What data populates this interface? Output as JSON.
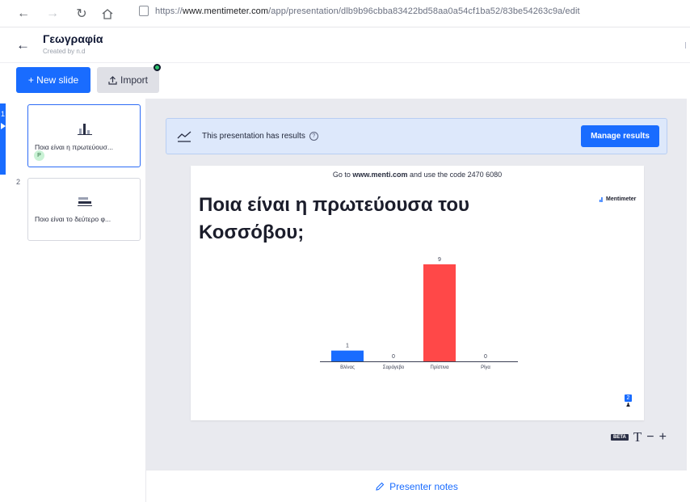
{
  "browser": {
    "url_prefix": "https://",
    "url_domain": "www.mentimeter.com",
    "url_path": "/app/presentation/dlb9b96cbba83422bd58aa0a54cf1ba52/83be54263c9a/edit"
  },
  "header": {
    "title": "Γεωγραφία",
    "subtitle": "Created by n.d"
  },
  "toolbar": {
    "new_slide_label": "+ New slide",
    "import_label": "Import"
  },
  "slides": [
    {
      "number": "1",
      "label": "Ποια είναι η πρωτεύουσ...",
      "badge": "P"
    },
    {
      "number": "2",
      "label": "Ποιο είναι το δεύτερο φ..."
    }
  ],
  "results": {
    "text": "This presentation has results",
    "help": "?",
    "button": "Manage results"
  },
  "slide": {
    "instruction_pre": "Go to ",
    "instruction_site": "www.menti.com",
    "instruction_post": " and use the code 2470 6080",
    "question": "Ποια είναι η πρωτεύουσα του Κοσσόβου;",
    "logo": "Mentimeter",
    "response_count": "2"
  },
  "chart_data": {
    "type": "bar",
    "categories": [
      "Βλίνας",
      "Σαράγεβο",
      "Πρίστινα",
      "Ρίγα"
    ],
    "values": [
      1,
      0,
      9,
      0
    ],
    "colors": [
      "#196cff",
      "#196cff",
      "#ff4848",
      "#196cff"
    ],
    "ylim": [
      0,
      9
    ]
  },
  "text_controls": {
    "beta": "BETA",
    "font": "T",
    "minus": "−",
    "plus": "+"
  },
  "notes": {
    "label": "Presenter notes"
  }
}
